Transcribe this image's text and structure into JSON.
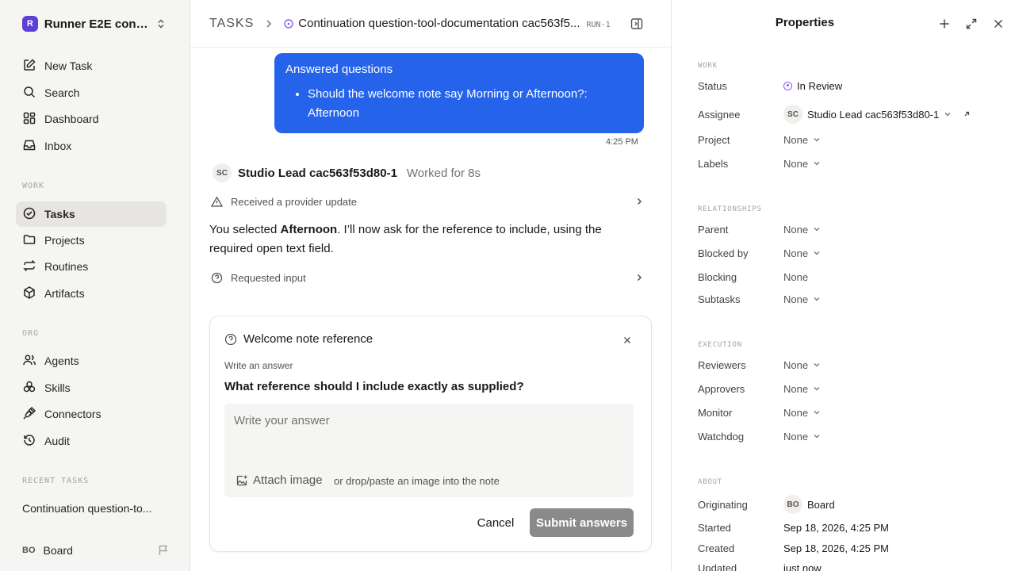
{
  "workspace": {
    "logo": "R",
    "name": "Runner E2E conti..."
  },
  "sidebar": {
    "top_items": [
      {
        "label": "New Task",
        "icon": "edit-icon"
      },
      {
        "label": "Search",
        "icon": "search-icon"
      },
      {
        "label": "Dashboard",
        "icon": "dashboard-icon"
      },
      {
        "label": "Inbox",
        "icon": "inbox-icon"
      }
    ],
    "work_label": "WORK",
    "work_items": [
      {
        "label": "Tasks",
        "icon": "check-circle-icon",
        "active": true
      },
      {
        "label": "Projects",
        "icon": "folder-icon"
      },
      {
        "label": "Routines",
        "icon": "repeat-icon"
      },
      {
        "label": "Artifacts",
        "icon": "cube-icon"
      }
    ],
    "org_label": "ORG",
    "org_items": [
      {
        "label": "Agents",
        "icon": "users-icon"
      },
      {
        "label": "Skills",
        "icon": "skills-icon"
      },
      {
        "label": "Connectors",
        "icon": "plug-icon"
      },
      {
        "label": "Audit",
        "icon": "history-icon"
      }
    ],
    "recent_label": "RECENT TASKS",
    "recent_task": "Continuation question-to...",
    "user": {
      "initials": "BO",
      "name": "Board"
    }
  },
  "header": {
    "root": "TASKS",
    "title": "Continuation question-tool-documentation cac563f5...",
    "run_tag": "RUN-1"
  },
  "chat": {
    "answered": {
      "title": "Answered questions",
      "item": "Should the welcome note say Morning or Afternoon?: Afternoon",
      "time": "4:25 PM"
    },
    "agent": {
      "initials": "SC",
      "name": "Studio Lead cac563f53d80-1",
      "worked": "Worked for 8s"
    },
    "event1": "Received a provider update",
    "message_pre": "You selected ",
    "message_bold": "Afternoon",
    "message_post": ". I’ll now ask for the reference to include, using the required open text field.",
    "event2": "Requested input"
  },
  "question_card": {
    "title": "Welcome note reference",
    "subtitle": "Write an answer",
    "question": "What reference should I include exactly as supplied?",
    "placeholder": "Write your answer",
    "attach_label": "Attach image",
    "attach_hint": "or drop/paste an image into the note",
    "cancel_label": "Cancel",
    "submit_label": "Submit answers"
  },
  "properties": {
    "title": "Properties",
    "work_label": "WORK",
    "status_label": "Status",
    "status_value": "In Review",
    "assignee_label": "Assignee",
    "assignee_initials": "SC",
    "assignee_value": "Studio Lead cac563f53d80-1",
    "project_label": "Project",
    "project_value": "None",
    "labels_label": "Labels",
    "labels_value": "None",
    "relationships_label": "RELATIONSHIPS",
    "parent_label": "Parent",
    "parent_value": "None",
    "blocked_by_label": "Blocked by",
    "blocked_by_value": "None",
    "blocking_label": "Blocking",
    "blocking_value": "None",
    "subtasks_label": "Subtasks",
    "subtasks_value": "None",
    "execution_label": "EXECUTION",
    "reviewers_label": "Reviewers",
    "reviewers_value": "None",
    "approvers_label": "Approvers",
    "approvers_value": "None",
    "monitor_label": "Monitor",
    "monitor_value": "None",
    "watchdog_label": "Watchdog",
    "watchdog_value": "None",
    "about_label": "ABOUT",
    "originating_label": "Originating",
    "originating_initials": "BO",
    "originating_value": "Board",
    "started_label": "Started",
    "started_value": "Sep 18, 2026, 4:25 PM",
    "created_label": "Created",
    "created_value": "Sep 18, 2026, 4:25 PM",
    "updated_label": "Updated",
    "updated_value": "just now"
  },
  "colors": {
    "accent_blue": "#2563eb",
    "brand_purple": "#5b3fd6",
    "status_purple": "#8b5cf6",
    "submit_disabled": "#8a8a8a"
  }
}
